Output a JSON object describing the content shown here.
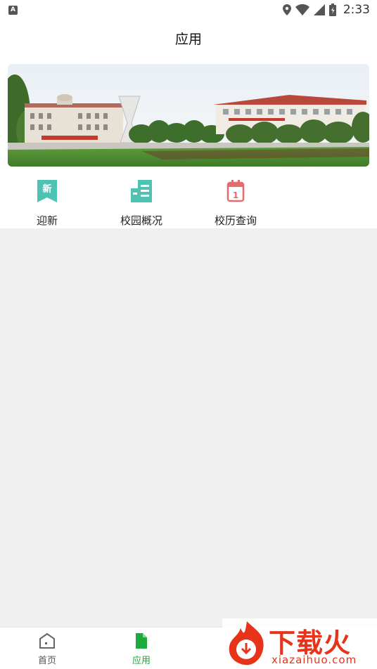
{
  "status_bar": {
    "time": "2:33",
    "left_badge": "A",
    "icons": [
      "location-icon",
      "wifi-icon",
      "signal-icon",
      "battery-icon"
    ]
  },
  "header": {
    "title": "应用"
  },
  "banner": {
    "description_icon": "campus-photo"
  },
  "quick_apps": [
    {
      "label": "迎新",
      "icon": "welcome-new-icon",
      "icon_text": "新",
      "color": "#4fc3b3"
    },
    {
      "label": "校园概况",
      "icon": "campus-building-icon",
      "color": "#4fc3b3"
    },
    {
      "label": "校历查询",
      "icon": "calendar-icon",
      "icon_text": "1",
      "color": "#e86a6a"
    }
  ],
  "bottom_nav": [
    {
      "label": "首页",
      "icon": "home-icon",
      "active": false
    },
    {
      "label": "应用",
      "icon": "document-icon",
      "active": true
    }
  ],
  "colors": {
    "accent": "#1aab3a",
    "inactive": "#555555",
    "page_bg": "#f0f0f0"
  },
  "watermark": {
    "text": "下载火",
    "sub": "xiazaihuo.com"
  }
}
